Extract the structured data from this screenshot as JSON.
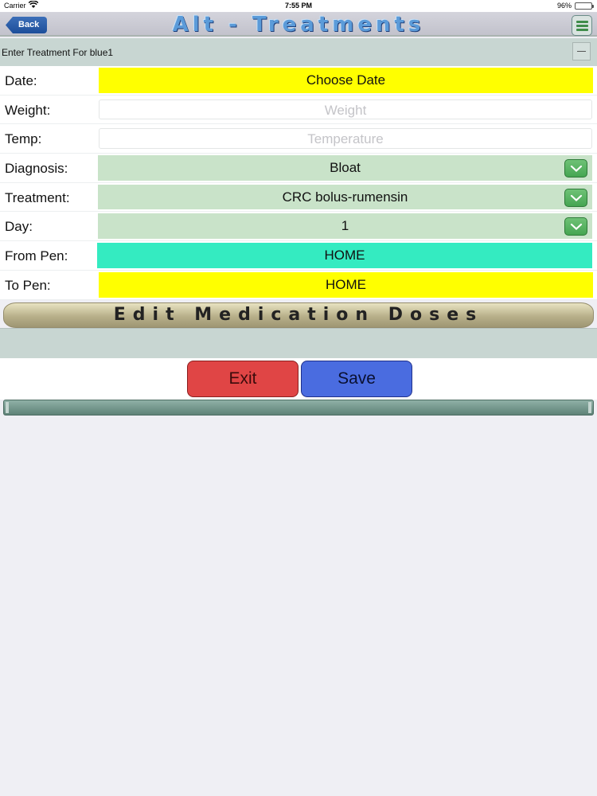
{
  "status_bar": {
    "carrier": "Carrier",
    "time": "7:55 PM",
    "battery": "96%",
    "battery_level": 0.96
  },
  "nav": {
    "back_label": "Back",
    "title": "Alt - Treatments"
  },
  "subheader": {
    "text": "Enter Treatment For blue1"
  },
  "form": {
    "date": {
      "label": "Date:",
      "value": "Choose Date"
    },
    "weight": {
      "label": "Weight:",
      "placeholder": "Weight"
    },
    "temp": {
      "label": "Temp:",
      "placeholder": "Temperature"
    },
    "diagnosis": {
      "label": "Diagnosis:",
      "value": "Bloat"
    },
    "treatment": {
      "label": "Treatment:",
      "value": "CRC bolus-rumensin"
    },
    "day": {
      "label": "Day:",
      "value": "1"
    },
    "from_pen": {
      "label": "From Pen:",
      "value": "HOME"
    },
    "to_pen": {
      "label": "To Pen:",
      "value": "HOME"
    }
  },
  "edit_doses_label": "Edit Medication Doses",
  "buttons": {
    "exit": "Exit",
    "save": "Save"
  },
  "colors": {
    "highlight_yellow": "#ffff00",
    "dropdown_green": "#c9e3c9",
    "pen_teal": "#34ebc1",
    "exit_red": "#e04545",
    "save_blue": "#4a6ce0"
  }
}
